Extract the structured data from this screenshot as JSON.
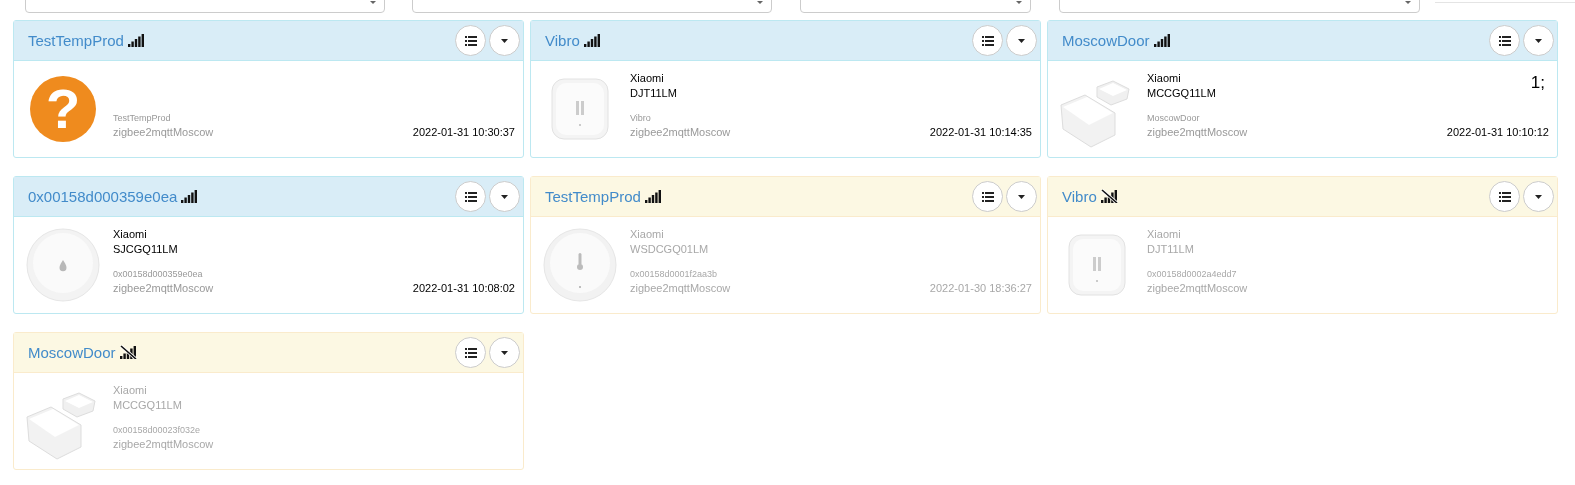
{
  "filters": [
    {
      "kind": "select"
    },
    {
      "kind": "select"
    },
    {
      "kind": "select"
    },
    {
      "kind": "select"
    },
    {
      "kind": "field"
    }
  ],
  "devices": [
    {
      "title": "TestTempProd",
      "no_signal": false,
      "online": true,
      "image": {
        "kind": "unknown",
        "symbol": "?"
      },
      "name": "TestTempProd",
      "gateway": "zigbee2mqttMoscow",
      "time": "2022-01-31 10:30:37"
    },
    {
      "title": "Vibro",
      "no_signal": false,
      "online": true,
      "image": {
        "kind": "vibration"
      },
      "vendor": "Xiaomi",
      "model": "DJT11LM",
      "name": "Vibro",
      "gateway": "zigbee2mqttMoscow",
      "time": "2022-01-31 10:14:35"
    },
    {
      "title": "MoscowDoor",
      "no_signal": false,
      "online": true,
      "image": {
        "kind": "door"
      },
      "vendor": "Xiaomi",
      "model": "MCCGQ11LM",
      "name": "MoscowDoor",
      "gateway": "zigbee2mqttMoscow",
      "time": "2022-01-31 10:10:12",
      "value": "1;"
    },
    {
      "title": "0x00158d000359e0ea",
      "no_signal": false,
      "online": true,
      "image": {
        "kind": "leak"
      },
      "vendor": "Xiaomi",
      "model": "SJCGQ11LM",
      "name": "0x00158d000359e0ea",
      "gateway": "zigbee2mqttMoscow",
      "time": "2022-01-31 10:08:02"
    },
    {
      "title": "TestTempProd",
      "no_signal": false,
      "online": false,
      "image": {
        "kind": "temperature"
      },
      "vendor": "Xiaomi",
      "model": "WSDCGQ01LM",
      "name": "0x00158d0001f2aa3b",
      "gateway": "zigbee2mqttMoscow",
      "time": "2022-01-30 18:36:27"
    },
    {
      "title": "Vibro",
      "no_signal": true,
      "online": false,
      "image": {
        "kind": "vibration"
      },
      "vendor": "Xiaomi",
      "model": "DJT11LM",
      "name": "0x00158d0002a4edd7",
      "gateway": "zigbee2mqttMoscow"
    },
    {
      "title": "MoscowDoor",
      "no_signal": true,
      "online": false,
      "image": {
        "kind": "door"
      },
      "vendor": "Xiaomi",
      "model": "MCCGQ11LM",
      "name": "0x00158d00023f032e",
      "gateway": "zigbee2mqttMoscow"
    }
  ]
}
